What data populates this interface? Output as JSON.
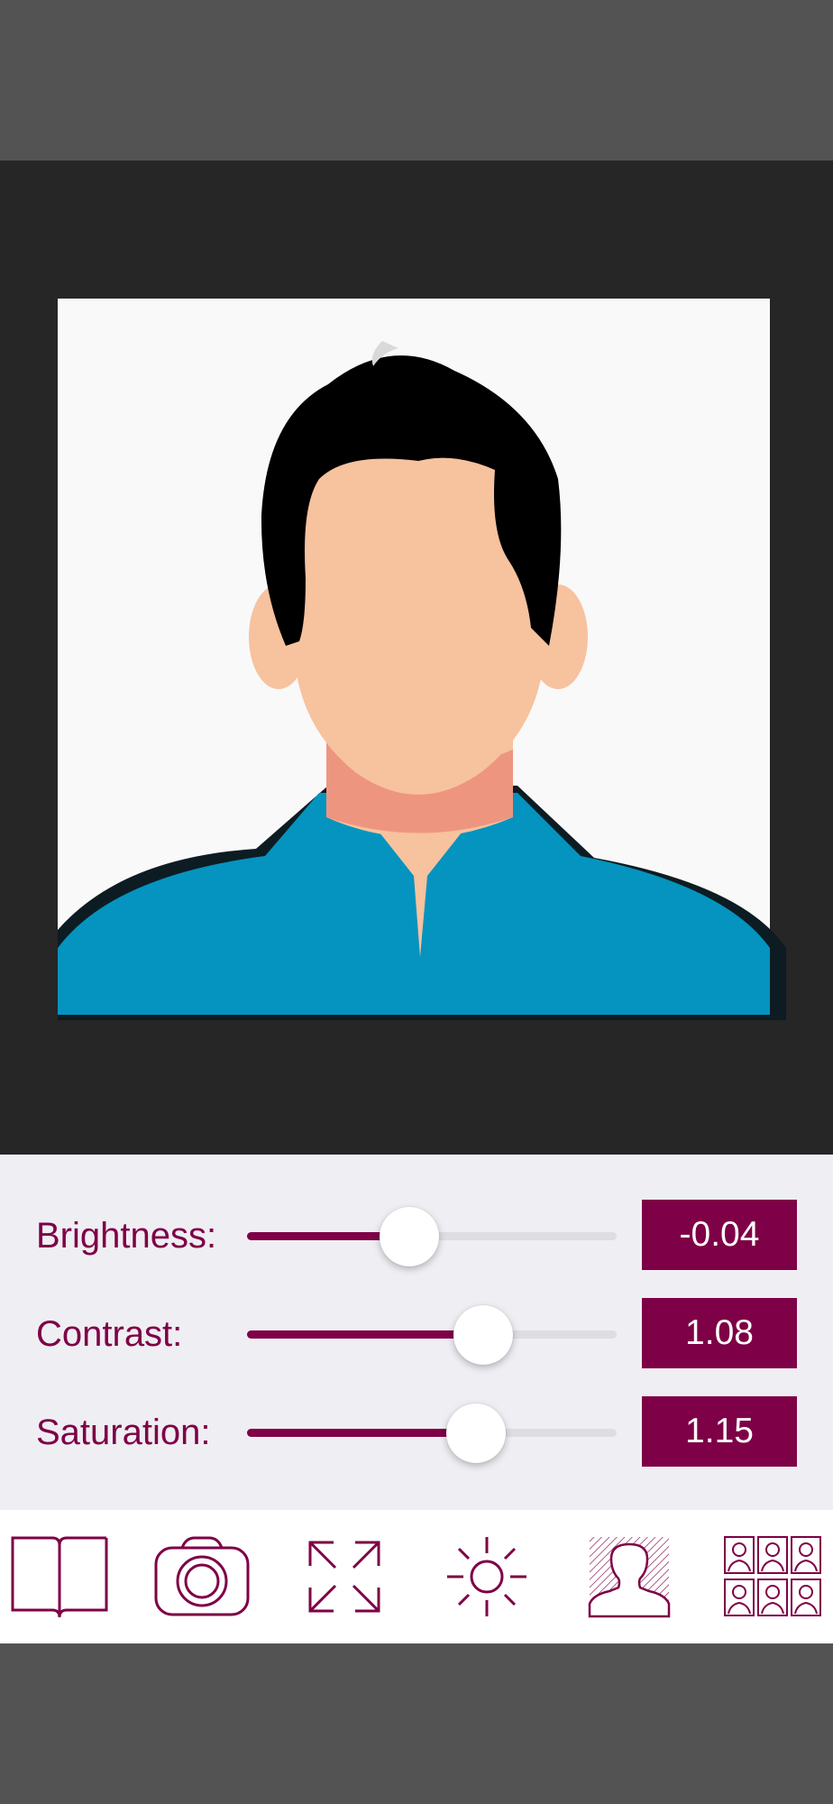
{
  "colors": {
    "accent": "#7e0046",
    "photo_background": "#262626",
    "controls_background": "#efeef3",
    "toolbar_background": "#ffffff",
    "chrome": "#535353"
  },
  "controls": {
    "brightness": {
      "label": "Brightness:",
      "value": "-0.04",
      "slider_fraction": 0.44
    },
    "contrast": {
      "label": "Contrast:",
      "value": "1.08",
      "slider_fraction": 0.64
    },
    "saturation": {
      "label": "Saturation:",
      "value": "1.15",
      "slider_fraction": 0.62
    }
  },
  "toolbar": {
    "items": [
      {
        "icon": "open-book-icon"
      },
      {
        "icon": "camera-icon"
      },
      {
        "icon": "expand-arrows-icon"
      },
      {
        "icon": "sun-brightness-icon"
      },
      {
        "icon": "person-background-icon",
        "selected": true
      },
      {
        "icon": "photo-grid-icon"
      }
    ]
  }
}
